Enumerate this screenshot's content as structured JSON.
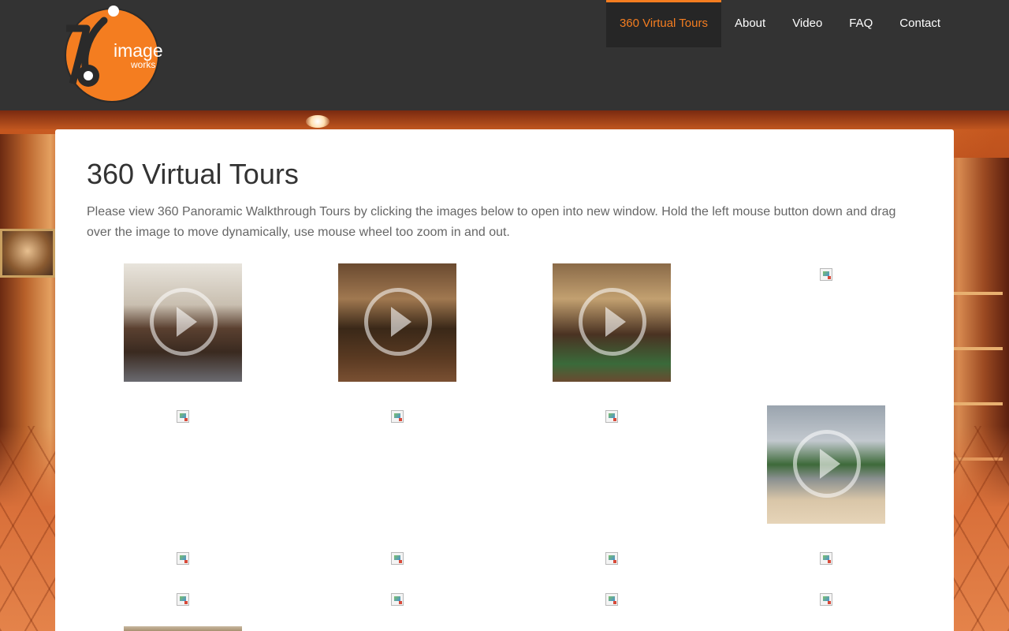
{
  "brand": {
    "logo_number": "36",
    "logo_word": "image",
    "logo_subword": "works",
    "colors": {
      "orange": "#f47d20",
      "header": "#333333",
      "text": "#333333"
    }
  },
  "nav": {
    "items": [
      {
        "label": "360 Virtual Tours",
        "active": true
      },
      {
        "label": "About",
        "active": false
      },
      {
        "label": "Video",
        "active": false
      },
      {
        "label": "FAQ",
        "active": false
      },
      {
        "label": "Contact",
        "active": false
      }
    ]
  },
  "main": {
    "title": "360 Virtual Tours",
    "intro": "Please view 360 Panoramic Walkthrough Tours by clicking the images below to open into new window. Hold the left mouse button down and drag over the image to move dynamically, use mouse wheel too zoom in and out."
  },
  "icons": {
    "play": "play-circle-icon",
    "broken_image": "broken-image-icon"
  }
}
